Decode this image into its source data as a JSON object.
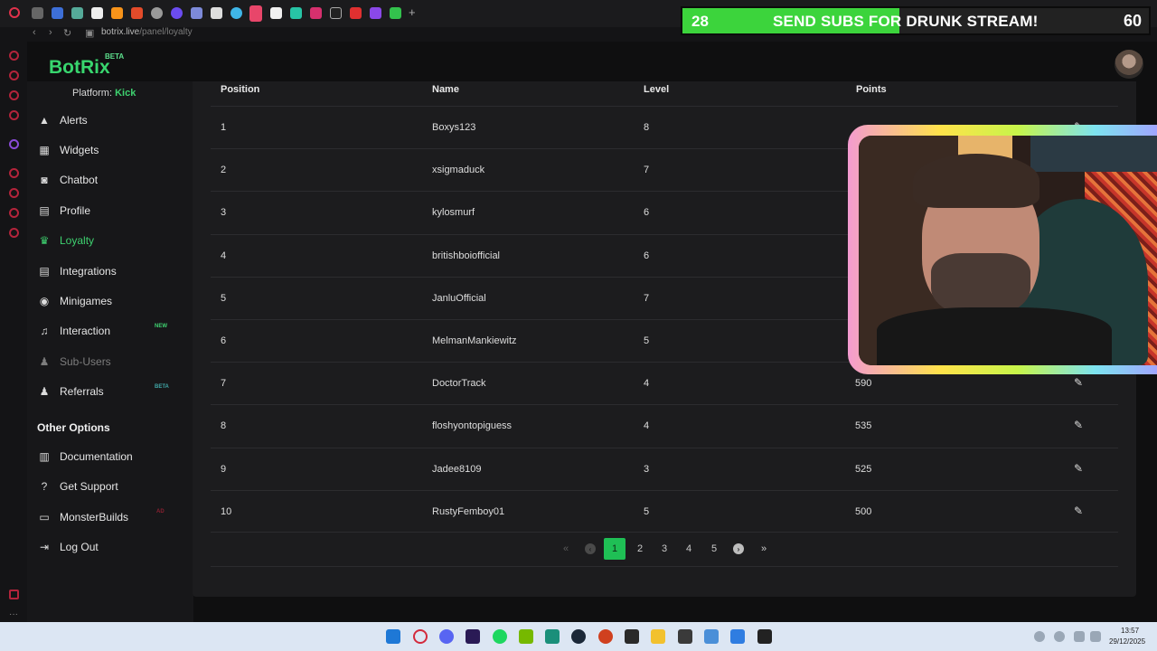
{
  "browser": {
    "url_host": "botrix.live",
    "url_path": "/panel/loyalty"
  },
  "overlay": {
    "subs_current": "28",
    "subs_message": "SEND SUBS FOR DRUNK STREAM!",
    "subs_goal": "60",
    "colors": {
      "fill": "#3cd43c",
      "frame_gradient": "pink-yellow-green-cyan"
    }
  },
  "app": {
    "logo": "BotRix",
    "logo_badge": "BETA",
    "platform_label": "Platform:",
    "platform_value": "Kick",
    "accent": "#3ed16f"
  },
  "sidebar": {
    "items": [
      {
        "label": "Alerts",
        "icon": "warning-icon"
      },
      {
        "label": "Widgets",
        "icon": "grid-icon"
      },
      {
        "label": "Chatbot",
        "icon": "robot-icon"
      },
      {
        "label": "Profile",
        "icon": "id-card-icon"
      },
      {
        "label": "Loyalty",
        "icon": "trophy-icon",
        "active": true
      },
      {
        "label": "Integrations",
        "icon": "list-icon"
      },
      {
        "label": "Minigames",
        "icon": "gamepad-icon"
      },
      {
        "label": "Interaction",
        "icon": "music-icon",
        "badge": "NEW"
      },
      {
        "label": "Sub-Users",
        "icon": "users-icon",
        "disabled": true
      },
      {
        "label": "Referrals",
        "icon": "users-icon",
        "badge": "BETA"
      }
    ],
    "other_title": "Other Options",
    "other_items": [
      {
        "label": "Documentation",
        "icon": "book-icon"
      },
      {
        "label": "Get Support",
        "icon": "question-icon"
      },
      {
        "label": "MonsterBuilds",
        "icon": "laptop-icon",
        "badge": "AD"
      },
      {
        "label": "Log Out",
        "icon": "logout-icon"
      }
    ]
  },
  "table": {
    "headers": [
      "Position",
      "Name",
      "Level",
      "Points"
    ],
    "rows": [
      {
        "position": "1",
        "name": "Boxys123",
        "level": "8",
        "points": ""
      },
      {
        "position": "2",
        "name": "xsigmaduck",
        "level": "7",
        "points": ""
      },
      {
        "position": "3",
        "name": "kylosmurf",
        "level": "6",
        "points": ""
      },
      {
        "position": "4",
        "name": "britishboiofficial",
        "level": "6",
        "points": ""
      },
      {
        "position": "5",
        "name": "JanluOfficial",
        "level": "7",
        "points": ""
      },
      {
        "position": "6",
        "name": "MelmanMankiewitz",
        "level": "5",
        "points": ""
      },
      {
        "position": "7",
        "name": "DoctorTrack",
        "level": "4",
        "points": "590"
      },
      {
        "position": "8",
        "name": "floshyontopiguess",
        "level": "4",
        "points": "535"
      },
      {
        "position": "9",
        "name": "Jadee8109",
        "level": "3",
        "points": "525"
      },
      {
        "position": "10",
        "name": "RustyFemboy01",
        "level": "5",
        "points": "500"
      }
    ]
  },
  "pagination": {
    "first": "«",
    "prev": "‹",
    "pages": [
      "1",
      "2",
      "3",
      "4",
      "5"
    ],
    "current": "1",
    "next": "›",
    "last": "»"
  },
  "taskbar": {
    "time": "13:57",
    "date": "29/12/2025"
  }
}
